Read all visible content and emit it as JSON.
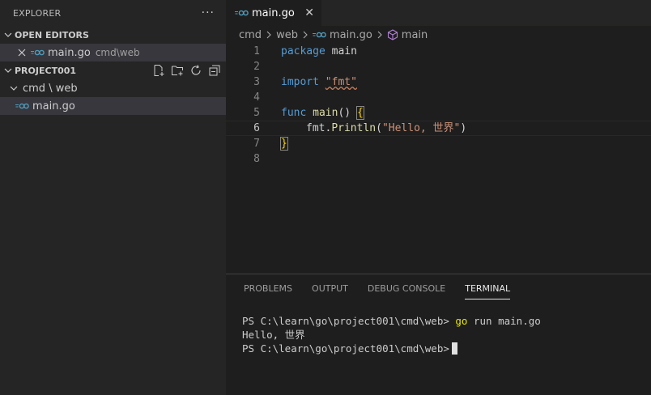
{
  "sidebar": {
    "title": "EXPLORER",
    "more": "···",
    "open_editors": {
      "label": "OPEN EDITORS",
      "items": [
        {
          "name": "main.go",
          "path": "cmd\\web"
        }
      ]
    },
    "project": {
      "label": "PROJECT001",
      "folder": "cmd \\ web",
      "file": "main.go"
    }
  },
  "tab": {
    "label": "main.go",
    "close": "✕"
  },
  "breadcrumb": {
    "a": "cmd",
    "b": "web",
    "c": "main.go",
    "d": "main"
  },
  "code": {
    "line_numbers": [
      "1",
      "2",
      "3",
      "4",
      "5",
      "6",
      "7",
      "8"
    ],
    "l1_kw": "package",
    "l1_name": "main",
    "l3_kw": "import",
    "l3_str": "\"fmt\"",
    "l5_kw": "func",
    "l5_fn": "main",
    "l5_parens": "()",
    "l5_brace": "{",
    "l6_pkg": "fmt",
    "l6_fn": "Println",
    "l6_str": "\"Hello, 世界\"",
    "l7_brace": "}"
  },
  "panel": {
    "tabs": [
      "PROBLEMS",
      "OUTPUT",
      "DEBUG CONSOLE",
      "TERMINAL"
    ],
    "terminal": {
      "prompt1": "PS C:\\learn\\go\\project001\\cmd\\web>",
      "cmd_go": "go",
      "cmd_rest": "run main.go",
      "output": "Hello, 世界",
      "prompt2": "PS C:\\learn\\go\\project001\\cmd\\web>"
    }
  },
  "colors": {
    "keyword": "#569cd6",
    "function": "#dcdcaa",
    "string": "#ce9178",
    "sidebar": "#252526",
    "editor": "#1e1e1e"
  }
}
